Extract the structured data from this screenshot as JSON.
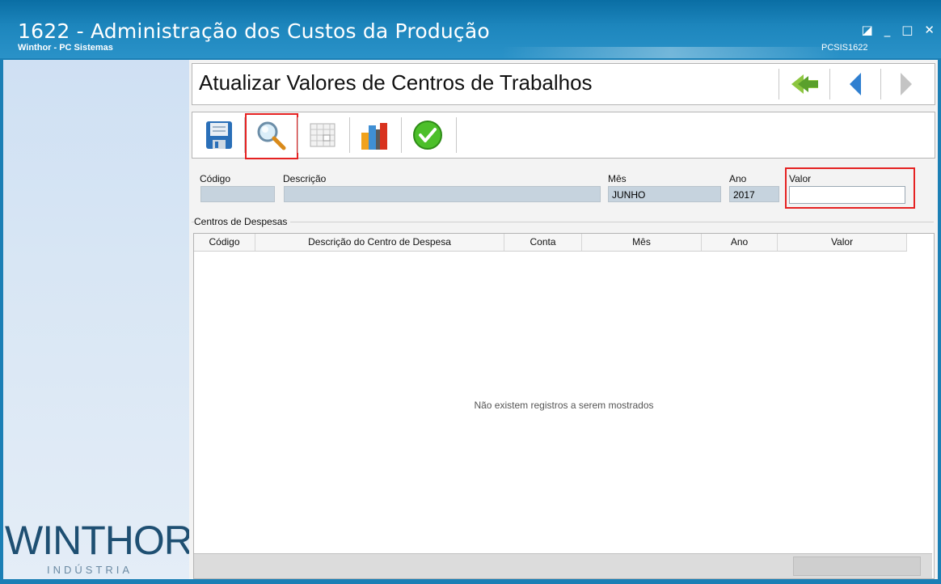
{
  "window": {
    "title": "1622 - Administração dos Custos da Produção",
    "subtitle": "Winthor - PC Sistemas",
    "code": "PCSIS1622",
    "controls": {
      "restore": "◪",
      "minimize": "_",
      "maximize": "□",
      "close": "✕"
    }
  },
  "sidebar": {
    "logo_main": "WINTHOR",
    "logo_sub": "INDÚSTRIA"
  },
  "page": {
    "heading": "Atualizar Valores de Centros de Trabalhos"
  },
  "nav": {
    "first_icon": "double-left-arrow-icon",
    "prev_icon": "left-arrow-icon",
    "next_icon": "right-arrow-icon"
  },
  "toolbar": {
    "buttons": [
      {
        "icon": "floppy-disk-icon",
        "name": "save"
      },
      {
        "icon": "magnifier-icon",
        "name": "search"
      },
      {
        "icon": "grid-icon",
        "name": "grid"
      },
      {
        "icon": "bar-chart-icon",
        "name": "chart"
      },
      {
        "icon": "check-circle-icon",
        "name": "confirm"
      }
    ],
    "accent": "#e52222"
  },
  "form": {
    "codigo": {
      "label": "Código",
      "value": ""
    },
    "descricao": {
      "label": "Descrição",
      "value": ""
    },
    "mes": {
      "label": "Mês",
      "value": "JUNHO"
    },
    "ano": {
      "label": "Ano",
      "value": "2017"
    },
    "valor": {
      "label": "Valor",
      "value": ""
    }
  },
  "group": {
    "label": "Centros de Despesas"
  },
  "table": {
    "columns": [
      "Código",
      "Descrição do Centro de Despesa",
      "Conta",
      "Mês",
      "Ano",
      "Valor"
    ],
    "rows": [],
    "empty_message": "Não existem registros a serem mostrados"
  },
  "colors": {
    "titlebar": "#1d86bd",
    "field_bg": "#c6d3de",
    "highlight": "#e52222"
  }
}
